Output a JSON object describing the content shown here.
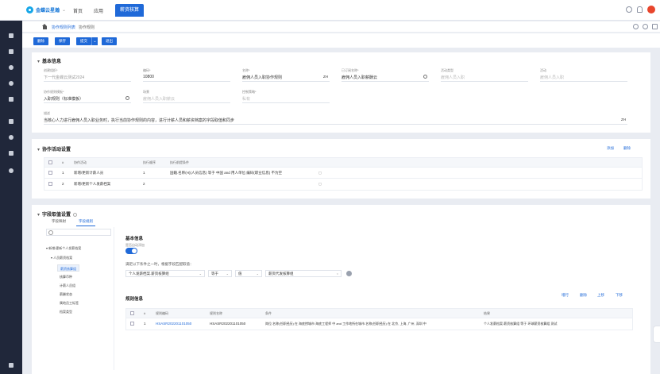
{
  "app": {
    "brand": "金蝶云星瀚",
    "nav": [
      "首页",
      "应用"
    ],
    "active_tab": "薪资核算"
  },
  "breadcrumb": [
    "协作规则列表",
    "协作规则"
  ],
  "toolbar": [
    "删除",
    "保存",
    "提交",
    "退出"
  ],
  "basic_info": {
    "title": "基本信息",
    "fields": [
      {
        "label": "创建组织*",
        "value": "下一代金蝶云测试2024",
        "placeholder": false
      },
      {
        "label": "编码*",
        "value": "10800",
        "placeholder": false
      },
      {
        "label": "名称*",
        "value": "雇佣人员入职协作规则",
        "suffix": "ZH",
        "placeholder": false
      },
      {
        "label": "已订阅名称*",
        "value": "雇佣人员入职薪酬云",
        "placeholder": false
      },
      {
        "label": "活动类型",
        "value": "雇佣人员入职",
        "placeholder": true
      },
      {
        "label": "活动",
        "value": "雇佣人员入职",
        "placeholder": true
      },
      {
        "label": "协作规则模板*",
        "value": "入职规则（标准模板）",
        "placeholder": false
      },
      {
        "label": "场景",
        "value": "雇佣人员入职薪云",
        "placeholder": true
      },
      {
        "label": "控制策略*",
        "value": "私有",
        "placeholder": true
      }
    ],
    "desc_label": "描述",
    "desc_value": "当核心人力进行雇佣人员入职业务时，执行当前协作规则的内容，进行计薪人员和薪资档案的字段取值和同步",
    "desc_suffix": "ZH"
  },
  "collab": {
    "title": "协作活动设置",
    "add": "添加",
    "delete": "删除",
    "headers": [
      "#",
      "协作活动",
      "执行顺序",
      "执行前提条件"
    ],
    "rows": [
      {
        "idx": "1",
        "activity": "新增/更新计薪人员",
        "order": "1",
        "condition": "国籍.名称(H)(人员信息) 等于 中国 and 用人单位.编码(职业信息) 不为空"
      },
      {
        "idx": "2",
        "activity": "新增/更新个人发薪档案",
        "order": "2",
        "condition": ""
      }
    ]
  },
  "mapping": {
    "title": "字段取值设置",
    "tabs": [
      "字段映射",
      "字段规则"
    ],
    "tree": [
      "新增/更新个人发薪档案",
      "人员薪资档案",
      "薪资核算组",
      "核算币种",
      "计薪人员组",
      "薪酬状态",
      "属地员工标签",
      "档案类型"
    ],
    "right_title": "基本信息",
    "auto_label": "是否自动添加",
    "match_hint": "满足以下条件之一时，根据字段匹配取值：",
    "selector_1": "个人发薪档案.薪资核算组",
    "selector_2": "等于",
    "selector_3": "值",
    "selector_4": "薪资代发核算组",
    "rule_title": "规则信息",
    "rule_actions": [
      "增行",
      "删除",
      "上移",
      "下移"
    ],
    "rule_headers": [
      "#",
      "规则编码",
      "规则名称",
      "条件",
      "结果"
    ],
    "rule_rows": [
      {
        "idx": "1",
        "code": "HSASR202201101050",
        "name": "HSASR202201101050",
        "condition": "岗位.名称(任职经历) 在 海底捞城市 海底工程师 中 and 工作地所在城市.名称(任职经历) 在 北京, 上海, 广州, 深圳 中",
        "result": "个人发薪档案.薪资核算组 等于 环球薪资核算组 测试"
      }
    ]
  }
}
